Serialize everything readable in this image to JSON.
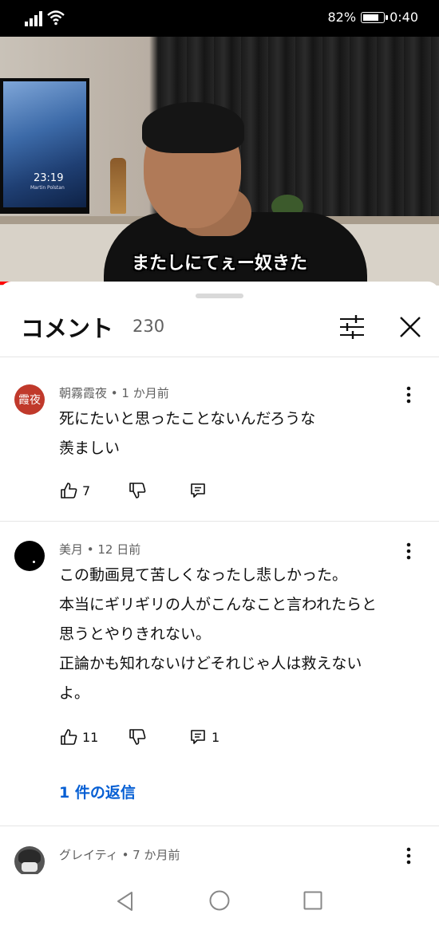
{
  "status_bar": {
    "battery": "82%",
    "time": "0:40",
    "battery_level": 0.82
  },
  "video": {
    "subtitle": "またしにてぇー奴きた",
    "tv_time": "23:19",
    "tv_date": "Martin Polstan",
    "progress": 0.066
  },
  "comments_panel": {
    "title": "コメント",
    "count": "230",
    "comments": [
      {
        "avatar_text": "霞夜",
        "avatar_color": "#c0392b",
        "meta": "朝霧霞夜 • 1 か月前",
        "lines": [
          "死にたいと思ったことないんだろうな",
          "羨ましい"
        ],
        "likes": "7",
        "replies": ""
      },
      {
        "avatar_text": "",
        "avatar_color": "#000000",
        "meta": "美月 • 12 日前",
        "lines": [
          "この動画見て苦しくなったし悲しかった。",
          "本当にギリギリの人がこんなこと言われたらと",
          "思うとやりきれない。",
          "正論かも知れないけどそれじゃ人は救えない",
          "よ。"
        ],
        "likes": "11",
        "replies": "1",
        "reply_link": "1 件の返信"
      },
      {
        "avatar_text": "",
        "avatar_color": "#555555",
        "meta": "グレイティ • 7 か月前"
      }
    ]
  },
  "icons": [
    "signal-icon",
    "wifi-icon",
    "battery-icon",
    "filter-icon",
    "close-icon",
    "more-icon",
    "like-icon",
    "dislike-icon",
    "reply-icon",
    "back-icon",
    "home-icon",
    "recents-icon"
  ],
  "colors": {
    "link": "#065fd4",
    "progress": "#ff0000"
  }
}
